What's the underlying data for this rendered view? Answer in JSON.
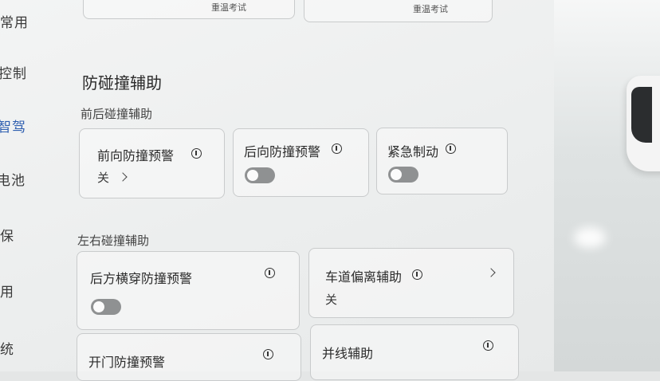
{
  "sidebar": {
    "items": [
      {
        "label": "常用"
      },
      {
        "label": "控制"
      },
      {
        "label": "智驾"
      },
      {
        "label": "电池"
      },
      {
        "label": "保"
      },
      {
        "label": "用"
      },
      {
        "label": "统"
      }
    ]
  },
  "top_cards": [
    {
      "caption": "重温考试"
    },
    {
      "caption": "重温考试"
    }
  ],
  "section": {
    "title": "防碰撞辅助"
  },
  "front_rear": {
    "title": "前后碰撞辅助",
    "cards": [
      {
        "label": "前向防撞预警",
        "status": "关"
      },
      {
        "label": "后向防撞预警",
        "toggle": "off"
      },
      {
        "label": "紧急制动",
        "toggle": "off"
      }
    ]
  },
  "left_right": {
    "title": "左右碰撞辅助",
    "cards": [
      {
        "label": "后方横穿防撞预警",
        "toggle": "off"
      },
      {
        "label": "车道偏离辅助",
        "status": "关"
      },
      {
        "label": "开门防撞预警"
      },
      {
        "label": "并线辅助"
      }
    ]
  },
  "colors": {
    "accent": "#3b6fd0",
    "active_nav": "#2f5fb0",
    "toggle_off": "#8f9192"
  }
}
